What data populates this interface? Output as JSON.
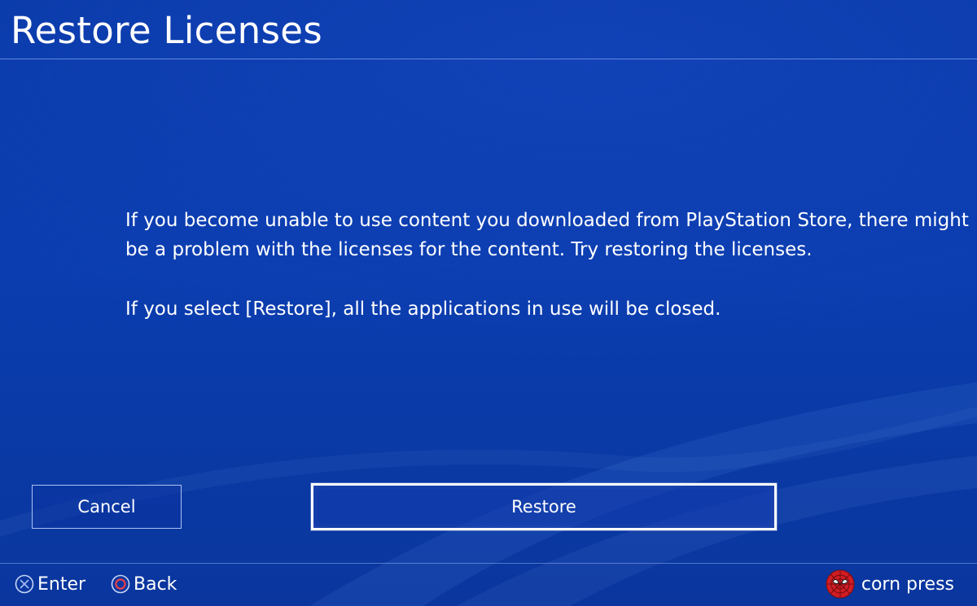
{
  "header": {
    "title": "Restore Licenses"
  },
  "message": {
    "paragraph_1": "If you become unable to use content you downloaded from PlayStation Store, there might be a problem with the licenses for the content. Try restoring the licenses.",
    "paragraph_2": "If you select [Restore], all the applications in use will be closed."
  },
  "buttons": {
    "cancel_label": "Cancel",
    "restore_label": "Restore",
    "focused": "restore"
  },
  "footer": {
    "enter": {
      "icon": "cross-button-icon",
      "label": "Enter"
    },
    "back": {
      "icon": "circle-button-icon",
      "label": "Back"
    },
    "user": {
      "avatar_icon": "spider-man-avatar",
      "name": "corn press"
    }
  },
  "colors": {
    "background": "#0b3db0",
    "text": "#ffffff",
    "circle_button": "#e8404a",
    "cross_button": "#9fb6f0",
    "avatar": "#d01d24"
  }
}
